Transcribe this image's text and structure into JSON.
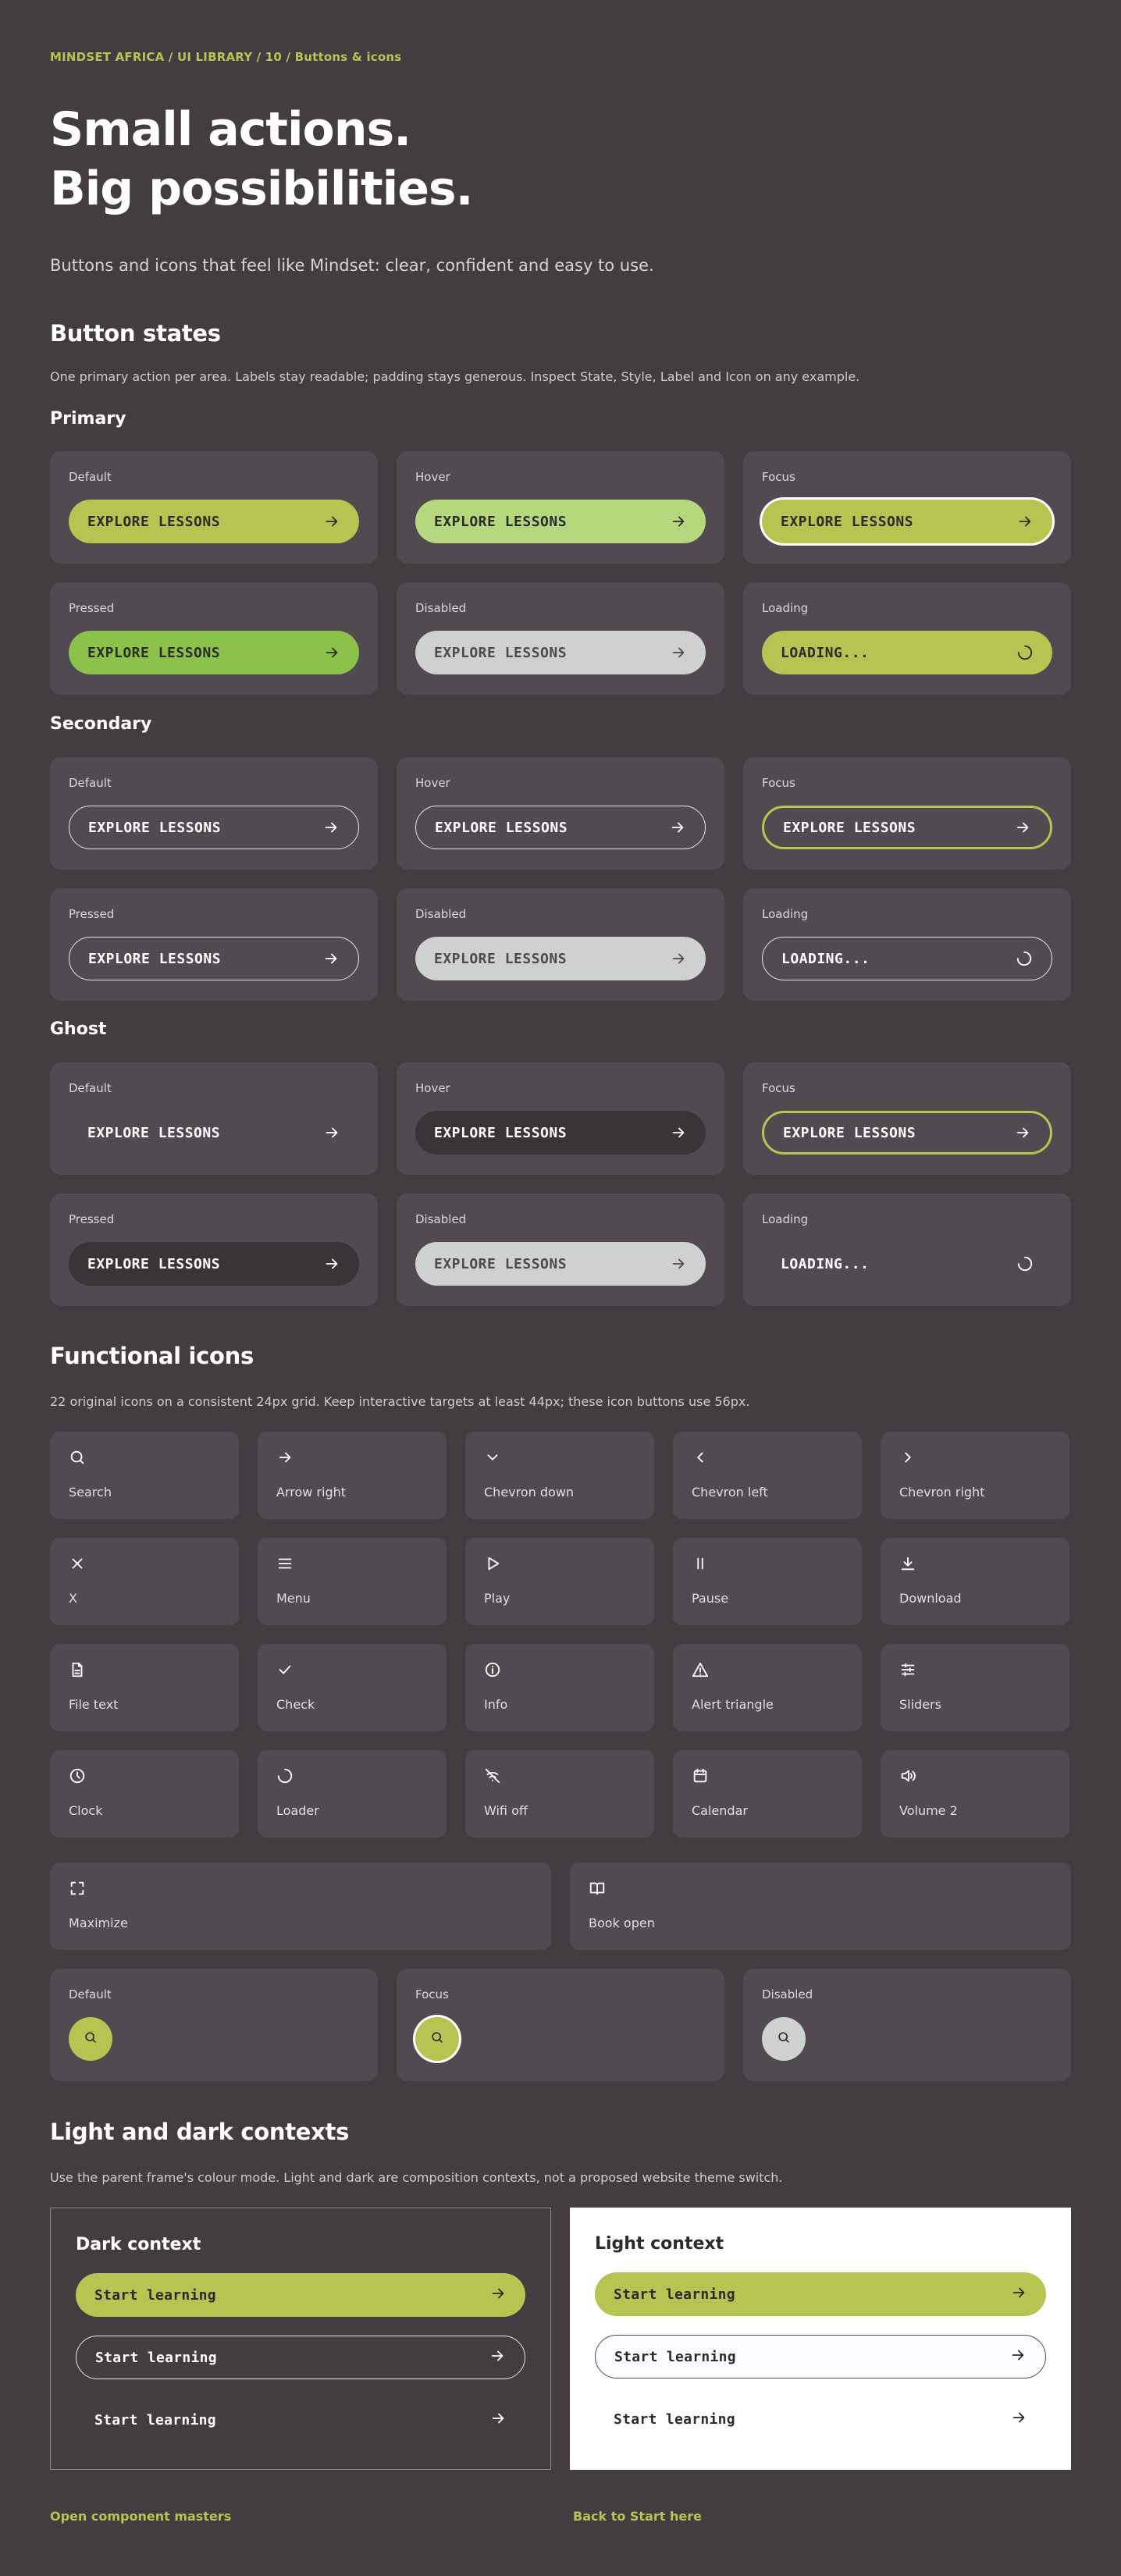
{
  "breadcrumb": "MINDSET AFRICA / UI LIBRARY / 10 / Buttons & icons",
  "hero": {
    "line1": "Small actions.",
    "line2": "Big possibilities."
  },
  "lead": "Buttons and icons that feel like Mindset: clear, confident and easy to use.",
  "button_states": {
    "title": "Button states",
    "description": "One primary action per area. Labels stay readable; padding stays generous. Inspect State, Style, Label and Icon on any example.",
    "primary": {
      "title": "Primary",
      "cards": [
        {
          "state": "Default",
          "label": "Explore lessons",
          "icon": "arrow-right"
        },
        {
          "state": "Hover",
          "label": "Explore lessons",
          "icon": "arrow-right"
        },
        {
          "state": "Focus",
          "label": "Explore lessons",
          "icon": "arrow-right"
        },
        {
          "state": "Pressed",
          "label": "Explore lessons",
          "icon": "arrow-right"
        },
        {
          "state": "Disabled",
          "label": "Explore lessons",
          "icon": "arrow-right"
        },
        {
          "state": "Loading",
          "label": "Loading...",
          "icon": "loader"
        }
      ]
    },
    "secondary": {
      "title": "Secondary",
      "cards": [
        {
          "state": "Default",
          "label": "Explore lessons",
          "icon": "arrow-right"
        },
        {
          "state": "Hover",
          "label": "Explore lessons",
          "icon": "arrow-right"
        },
        {
          "state": "Focus",
          "label": "Explore lessons",
          "icon": "arrow-right"
        },
        {
          "state": "Pressed",
          "label": "Explore lessons",
          "icon": "arrow-right"
        },
        {
          "state": "Disabled",
          "label": "Explore lessons",
          "icon": "arrow-right"
        },
        {
          "state": "Loading",
          "label": "Loading...",
          "icon": "loader"
        }
      ]
    },
    "ghost": {
      "title": "Ghost",
      "cards": [
        {
          "state": "Default",
          "label": "Explore lessons",
          "icon": "arrow-right"
        },
        {
          "state": "Hover",
          "label": "Explore lessons",
          "icon": "arrow-right"
        },
        {
          "state": "Focus",
          "label": "Explore lessons",
          "icon": "arrow-right"
        },
        {
          "state": "Pressed",
          "label": "Explore lessons",
          "icon": "arrow-right"
        },
        {
          "state": "Disabled",
          "label": "Explore lessons",
          "icon": "arrow-right"
        },
        {
          "state": "Loading",
          "label": "Loading...",
          "icon": "loader"
        }
      ]
    }
  },
  "functional_icons": {
    "title": "Functional icons",
    "description": "22 original icons on a consistent 24px grid. Keep interactive targets at least 44px; these icon buttons use 56px.",
    "icons": [
      {
        "name": "Search",
        "icon": "search-icon"
      },
      {
        "name": "Arrow right",
        "icon": "arrow-right-icon"
      },
      {
        "name": "Chevron down",
        "icon": "chevron-down-icon"
      },
      {
        "name": "Chevron left",
        "icon": "chevron-left-icon"
      },
      {
        "name": "Chevron right",
        "icon": "chevron-right-icon"
      },
      {
        "name": "X",
        "icon": "x-icon"
      },
      {
        "name": "Menu",
        "icon": "menu-icon"
      },
      {
        "name": "Play",
        "icon": "play-icon"
      },
      {
        "name": "Pause",
        "icon": "pause-icon"
      },
      {
        "name": "Download",
        "icon": "download-icon"
      },
      {
        "name": "File text",
        "icon": "file-text-icon"
      },
      {
        "name": "Check",
        "icon": "check-icon"
      },
      {
        "name": "Info",
        "icon": "info-icon"
      },
      {
        "name": "Alert triangle",
        "icon": "alert-triangle-icon"
      },
      {
        "name": "Sliders",
        "icon": "sliders-icon"
      },
      {
        "name": "Clock",
        "icon": "clock-icon"
      },
      {
        "name": "Loader",
        "icon": "loader-icon"
      },
      {
        "name": "Wifi off",
        "icon": "wifi-off-icon"
      },
      {
        "name": "Calendar",
        "icon": "calendar-icon"
      },
      {
        "name": "Volume 2",
        "icon": "volume-2-icon"
      }
    ],
    "wide_icons": [
      {
        "name": "Maximize",
        "icon": "maximize-icon"
      },
      {
        "name": "Book open",
        "icon": "book-open-icon"
      }
    ],
    "icon_buttons": [
      {
        "state": "Default",
        "icon": "search-icon"
      },
      {
        "state": "Focus",
        "icon": "search-icon"
      },
      {
        "state": "Disabled",
        "icon": "search-icon"
      }
    ]
  },
  "contexts": {
    "title": "Light and dark contexts",
    "description": "Use the parent frame's colour mode. Light and dark are composition contexts, not a proposed website theme switch.",
    "dark": {
      "title": "Dark context",
      "primary_label": "Start learning",
      "secondary_label": "Start learning",
      "ghost_label": "Start learning"
    },
    "light": {
      "title": "Light context",
      "primary_label": "Start learning",
      "secondary_label": "Start learning",
      "ghost_label": "Start learning"
    }
  },
  "footer": {
    "link_left": "Open component masters",
    "link_right": "Back to Start here"
  },
  "colors": {
    "background": "#433d42",
    "card": "#514a50",
    "accent": "#b8c452",
    "hover": "#b5d87f",
    "pressed": "#8bc34a",
    "disabled": "#cfd1d0"
  }
}
